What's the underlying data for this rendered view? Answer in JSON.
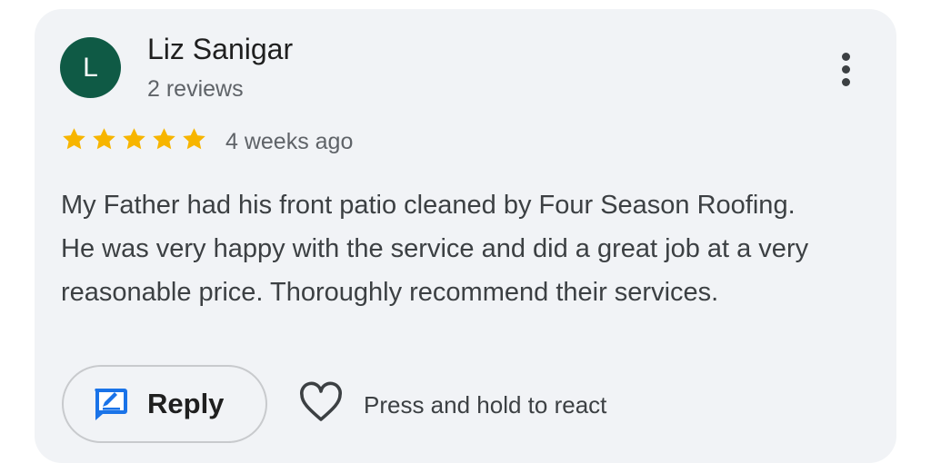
{
  "review": {
    "avatar_initial": "L",
    "author_name": "Liz Sanigar",
    "review_count": "2 reviews",
    "rating": 5,
    "rating_max": 5,
    "time_ago": "4 weeks ago",
    "text": "My Father had his front patio cleaned by Four Season Roofing. He was very happy with the service and did a great job at a very reasonable price. Thoroughly recommend their services."
  },
  "actions": {
    "reply_label": "Reply",
    "react_hint": "Press and hold to react"
  },
  "icons": {
    "more": "more-vertical-icon",
    "star": "star-icon",
    "reply": "reply-edit-icon",
    "react": "heart-outline-icon"
  },
  "colors": {
    "avatar_bg": "#0f5a45",
    "star": "#f7b500",
    "reply_icon": "#1a73e8",
    "card_bg": "#f1f3f6"
  }
}
